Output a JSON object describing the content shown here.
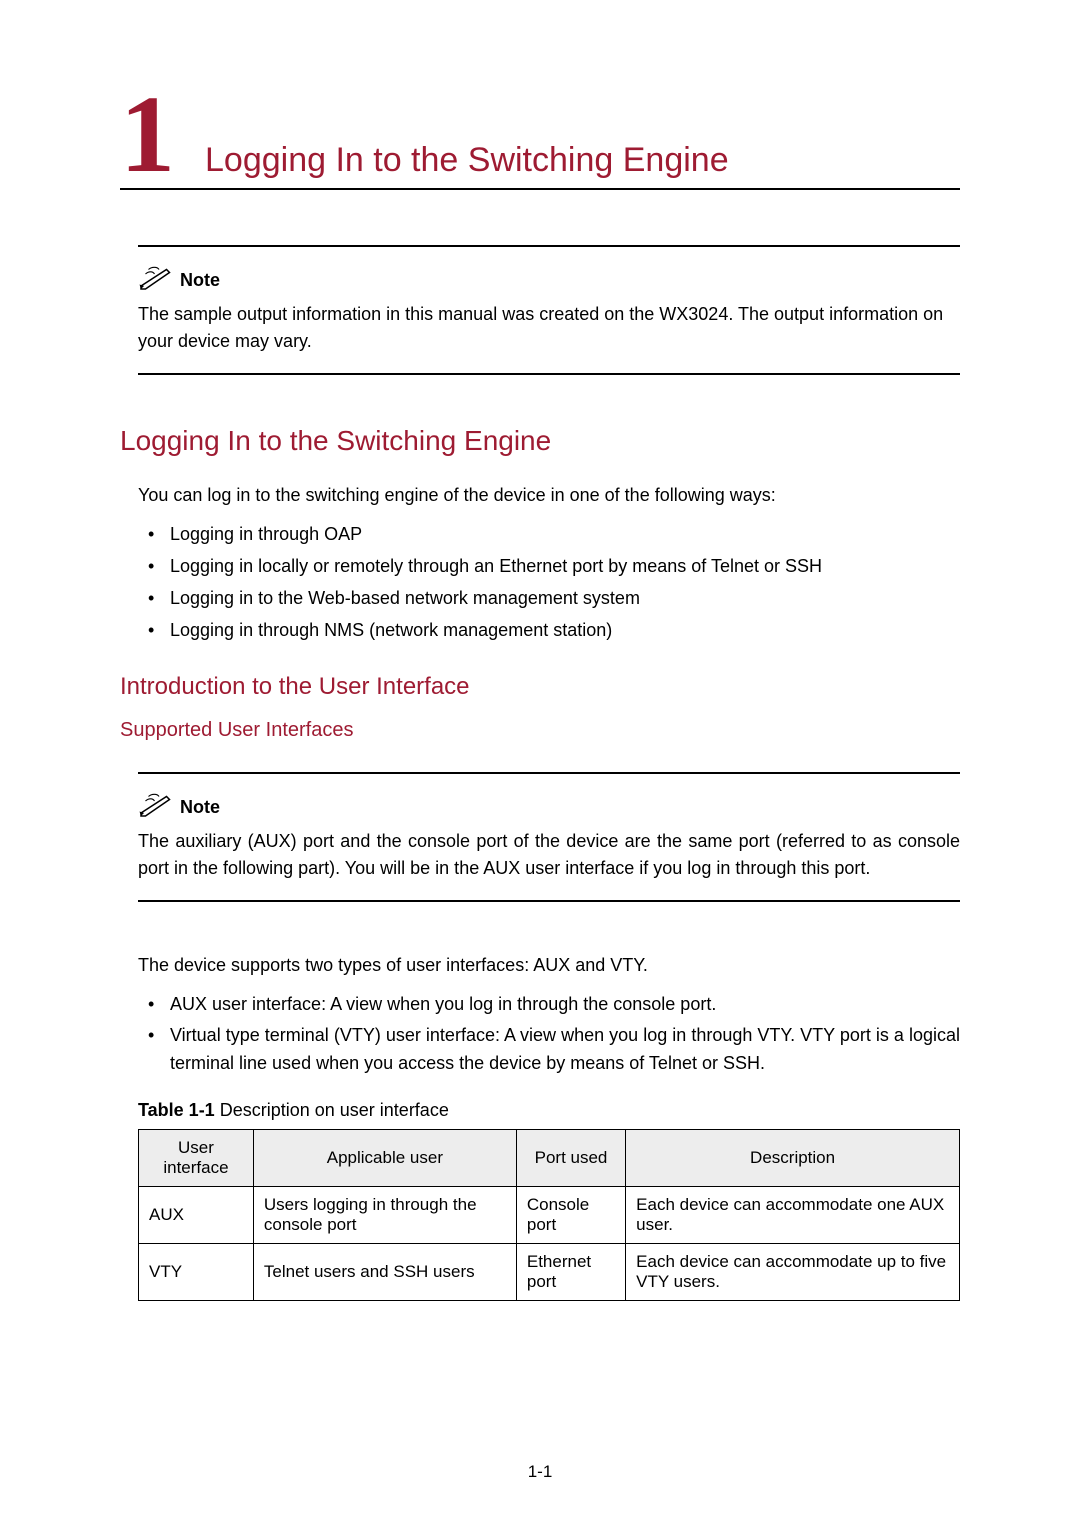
{
  "chapter": {
    "number": "1",
    "title": "Logging In to the Switching Engine"
  },
  "note1": {
    "label": "Note",
    "text": "The sample output information in this manual was created on the WX3024. The output information on your device may vary."
  },
  "section1": {
    "heading": "Logging In to the Switching Engine",
    "intro": "You can log in to the switching engine of the device in one of the following ways:",
    "items": [
      "Logging in through OAP",
      "Logging in locally or remotely through an Ethernet port by means of Telnet or SSH",
      "Logging in to the Web-based network management system",
      "Logging in through NMS (network management station)"
    ]
  },
  "section2": {
    "heading": "Introduction to the User Interface",
    "sub1": "Supported User Interfaces"
  },
  "note2": {
    "label": "Note",
    "text": "The auxiliary (AUX) port and the console port of the device are the same port (referred to as console port in the following part). You will be in the AUX user interface if you log in through this port."
  },
  "para_after_note2": "The device supports two types of user interfaces: AUX and VTY.",
  "bulletsB": [
    "AUX user interface: A view when you log in through the console port.",
    "Virtual type terminal (VTY) user interface: A view when you log in through VTY. VTY port is a logical terminal line used when you access the device by means of Telnet or SSH."
  ],
  "table": {
    "caption_label": "Table 1-1",
    "caption_text": "Description on user interface",
    "headers": [
      "User interface",
      "Applicable user",
      "Port used",
      "Description"
    ],
    "rows": [
      [
        "AUX",
        "Users logging in through the console port",
        "Console port",
        "Each device can accommodate one AUX user."
      ],
      [
        "VTY",
        "Telnet users and SSH users",
        "Ethernet port",
        "Each device can accommodate up to five VTY users."
      ]
    ]
  },
  "page_number": "1-1"
}
